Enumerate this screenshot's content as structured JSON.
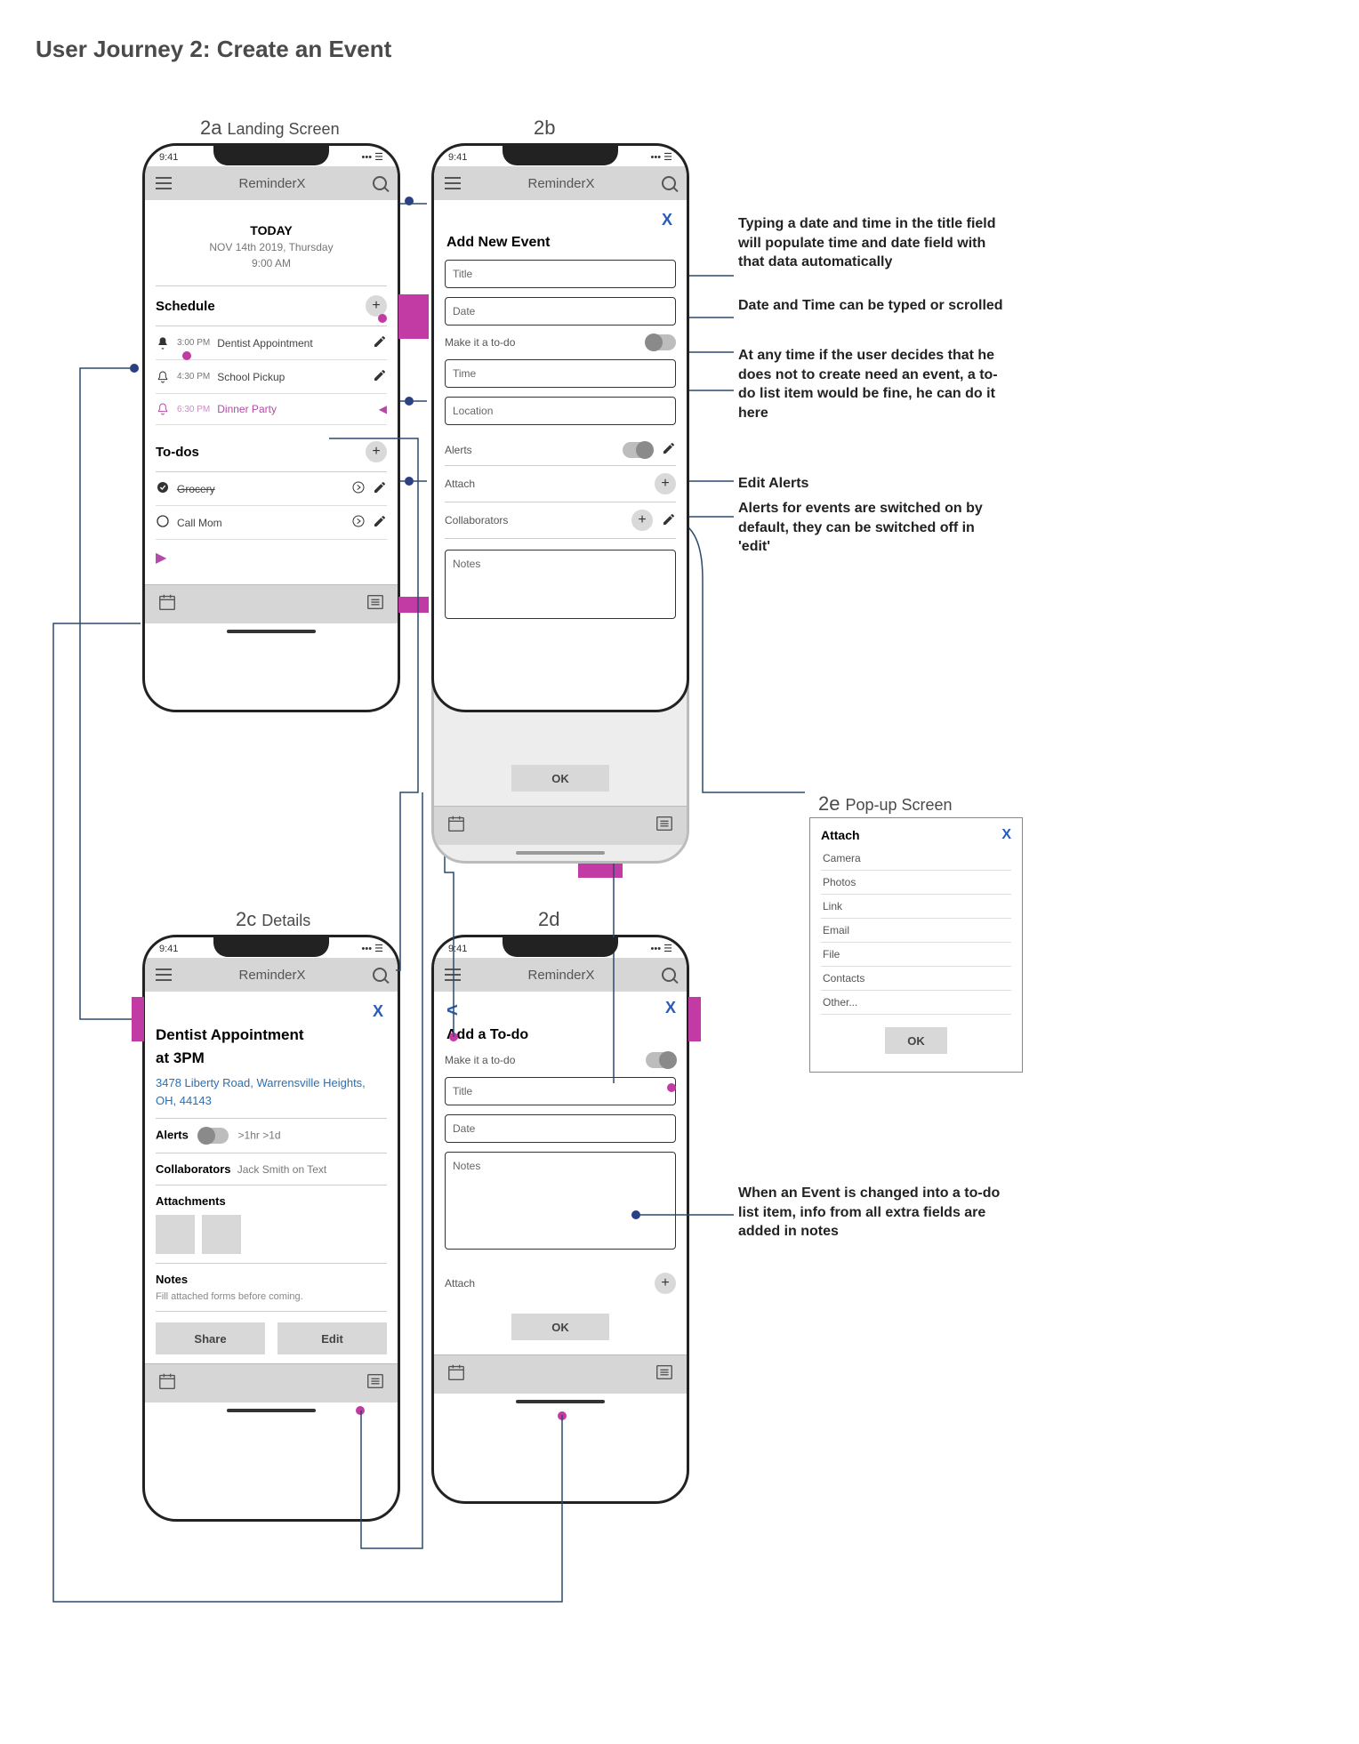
{
  "page_title": "User Journey 2: Create an Event",
  "labels": {
    "a": "2a",
    "a_t": "Landing Screen",
    "b": "2b",
    "c": "2c",
    "c_t": "Details",
    "d": "2d",
    "e": "2e",
    "e_t": "Pop-up Screen"
  },
  "statusbar_time": "9:41",
  "app_title": "ReminderX",
  "screen2a": {
    "today": "TODAY",
    "date": "NOV 14th 2019, Thursday",
    "time": "9:00 AM",
    "schedule_head": "Schedule",
    "items": [
      {
        "time": "3:00 PM",
        "label": "Dentist Appointment",
        "alert": true
      },
      {
        "time": "4:30 PM",
        "label": "School Pickup",
        "alert": false
      },
      {
        "time": "6:30 PM",
        "label": "Dinner Party",
        "alert": false
      }
    ],
    "todos_head": "To-dos",
    "todos": [
      {
        "label": "Grocery",
        "done": true
      },
      {
        "label": "Call Mom",
        "done": false
      }
    ]
  },
  "screen2b": {
    "title": "Add New Event",
    "fields": {
      "title": "Title",
      "date": "Date",
      "make_todo": "Make it a to-do",
      "time": "Time",
      "location": "Location",
      "alerts": "Alerts",
      "attach": "Attach",
      "collab": "Collaborators",
      "notes": "Notes"
    },
    "ok": "OK"
  },
  "screen2c": {
    "title": "Dentist Appointment",
    "subtitle": "at 3PM",
    "address": "3478 Liberty Road, Warrensville Heights, OH, 44143",
    "alerts": "Alerts",
    "alerts_val": ">1hr  >1d",
    "collab": "Collaborators",
    "collab_val": "Jack Smith on Text",
    "attach": "Attachments",
    "notes": "Notes",
    "notes_val": "Fill attached forms before coming.",
    "share": "Share",
    "edit": "Edit"
  },
  "screen2d": {
    "title": "Add a To-do",
    "make_todo": "Make it a to-do",
    "fields": {
      "title": "Title",
      "date": "Date",
      "notes": "Notes",
      "attach": "Attach"
    },
    "ok": "OK"
  },
  "popup": {
    "title": "Attach",
    "options": [
      "Camera",
      "Photos",
      "Link",
      "Email",
      "File",
      "Contacts",
      "Other..."
    ],
    "ok": "OK"
  },
  "annotations": {
    "a1": "Typing a date and time in the title field will populate time and date field with that data automatically",
    "a2": "Date and Time can be typed or scrolled",
    "a3": "At any time if the user decides that he does not to create need an event, a to-do list item would be fine, he can do it here",
    "a4": "Edit Alerts",
    "a5": "Alerts for events are switched on by default, they can be switched off in 'edit'",
    "a6": "When an Event is changed into a to-do list item, info from all extra fields are added in notes"
  }
}
